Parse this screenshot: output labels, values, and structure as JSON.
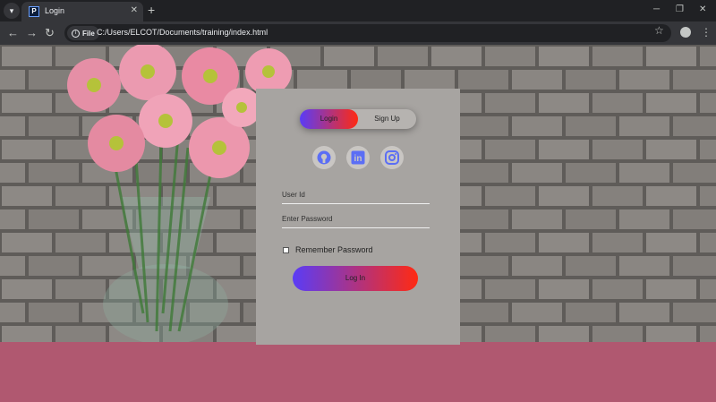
{
  "browser": {
    "tab_title": "Login",
    "url": "C:/Users/ELCOT/Documents/training/index.html",
    "security_chip": "File",
    "newtab_glyph": "+",
    "tab_close_glyph": "✕"
  },
  "colors": {
    "gradient_start": "#5a3cf6",
    "gradient_end": "#ff2a12",
    "card_background": "#a7a4a1",
    "icon_color": "#5b6ef5"
  },
  "login_form": {
    "toggle": {
      "login_label": "Login",
      "signup_label": "Sign Up",
      "active": "login"
    },
    "social_icons": [
      "github-icon",
      "linkedin-icon",
      "instagram-icon"
    ],
    "user_id_placeholder": "User Id",
    "password_placeholder": "Enter Password",
    "remember_label": "Remember Password",
    "remember_checked": false,
    "submit_label": "Log In"
  }
}
